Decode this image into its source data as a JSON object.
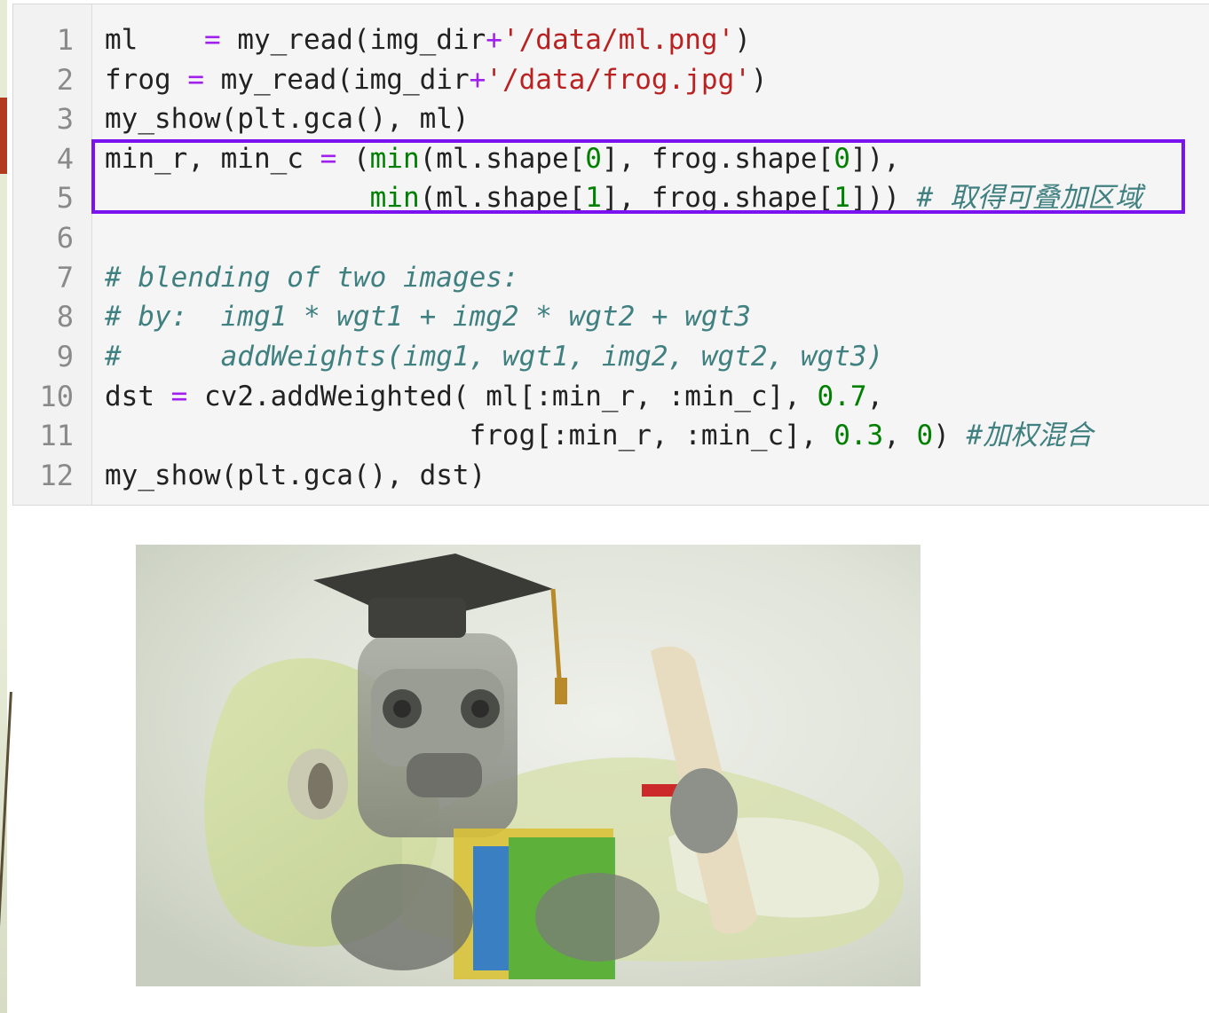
{
  "line_numbers": [
    "1",
    "2",
    "3",
    "4",
    "5",
    "6",
    "7",
    "8",
    "9",
    "10",
    "11",
    "12"
  ],
  "code": {
    "l1": {
      "var": "ml",
      "spaces": "    ",
      "eq": "=",
      "call": " my_read(img_dir",
      "plus": "+",
      "str": "'/data/ml.png'",
      "close": ")"
    },
    "l2": {
      "var": "frog",
      "eq": " = ",
      "call": "my_read(img_dir",
      "plus": "+",
      "str": "'/data/frog.jpg'",
      "close": ")"
    },
    "l3": {
      "text": "my_show(plt.gca(), ml)"
    },
    "l4": {
      "left": "min_r, min_c ",
      "eq": "=",
      "open": " (",
      "min": "min",
      "args_a": "(ml.shape[",
      "n0a": "0",
      "args_b": "], frog.shape[",
      "n0b": "0",
      "tail": "]),"
    },
    "l5": {
      "indent": "                ",
      "min": "min",
      "args_a": "(ml.shape[",
      "n1a": "1",
      "args_b": "], frog.shape[",
      "n1b": "1",
      "tail": "])) ",
      "comment": "# 取得可叠加区域"
    },
    "l7": {
      "comment": "# blending of two images:"
    },
    "l8": {
      "comment": "# by:  img1 * wgt1 + img2 * wgt2 + wgt3"
    },
    "l9": {
      "comment": "#      addWeights(img1, wgt1, img2, wgt2, wgt3)"
    },
    "l10": {
      "a": "dst ",
      "eq": "=",
      "b": " cv2.addWeighted( ml[:min_r, :min_c], ",
      "n": "0.7",
      "c": ","
    },
    "l11": {
      "indent": "                      ",
      "a": "frog[:min_r, :min_c], ",
      "n1": "0.3",
      "b": ", ",
      "n2": "0",
      "c": ") ",
      "comment": "#加权混合"
    },
    "l12": {
      "text": "my_show(plt.gca(), dst)"
    }
  },
  "output": {
    "image_description_icon": "blended-robot-frog-image"
  },
  "colors": {
    "highlight_box": "#7b12f0",
    "operator": "#a020f0",
    "string": "#ba2121",
    "number": "#008000",
    "comment": "#408080"
  }
}
